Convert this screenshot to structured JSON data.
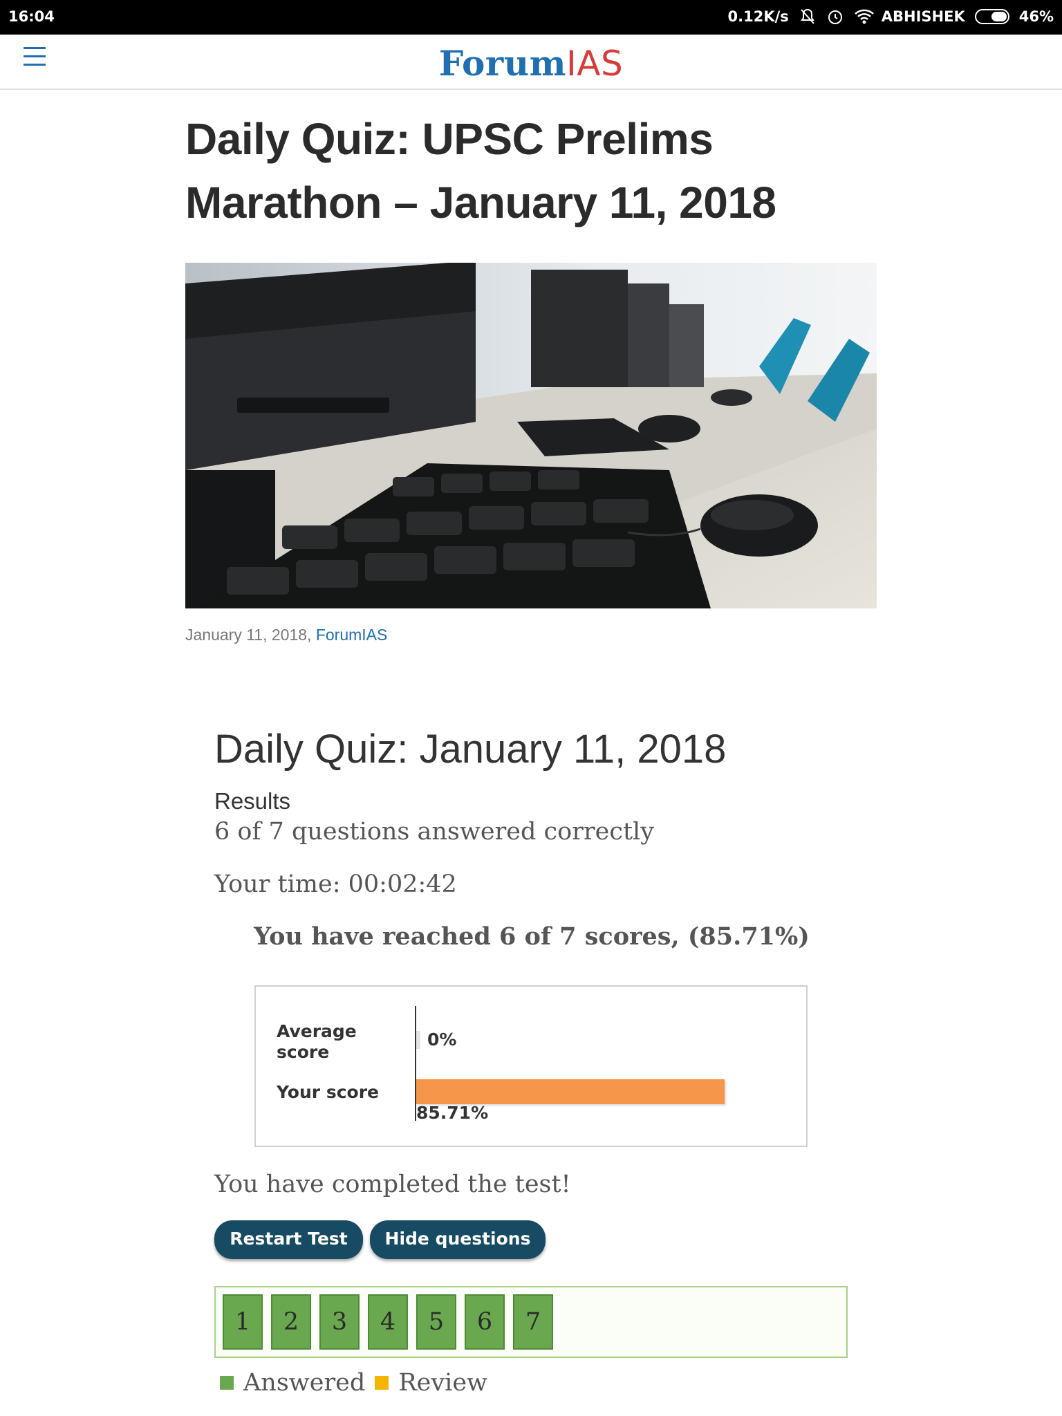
{
  "status_bar": {
    "time": "16:04",
    "net_speed": "0.12K/s",
    "carrier": "ABHISHEK",
    "battery": "46%"
  },
  "header": {
    "logo_part1": "Forum",
    "logo_part2": "IAS"
  },
  "article": {
    "title": "Daily Quiz: UPSC Prelims Marathon – January 11, 2018",
    "date": "January 11, 2018",
    "author": "ForumIAS"
  },
  "quiz": {
    "title": "Daily Quiz: January 11, 2018",
    "results_label": "Results",
    "answered_line": "6 of 7 questions answered correctly",
    "time_line": "Your time: 00:02:42",
    "reached_line": "You have reached 6 of 7 scores, (85.71%)",
    "completed_line": "You have completed the test!",
    "restart_label": "Restart Test",
    "hide_label": "Hide questions",
    "questions": [
      "1",
      "2",
      "3",
      "4",
      "5",
      "6",
      "7"
    ],
    "legend_answered": "Answered",
    "legend_review": "Review",
    "colors": {
      "answered": "#6aa84f",
      "review": "#f5b400",
      "your_score_bar": "#f5964a",
      "button": "#174a63"
    }
  },
  "chart_data": {
    "type": "bar",
    "orientation": "horizontal",
    "categories": [
      "Average score",
      "Your score"
    ],
    "values": [
      0,
      85.71
    ],
    "value_labels": [
      "0%",
      "85.71%"
    ],
    "xlim": [
      0,
      100
    ]
  }
}
